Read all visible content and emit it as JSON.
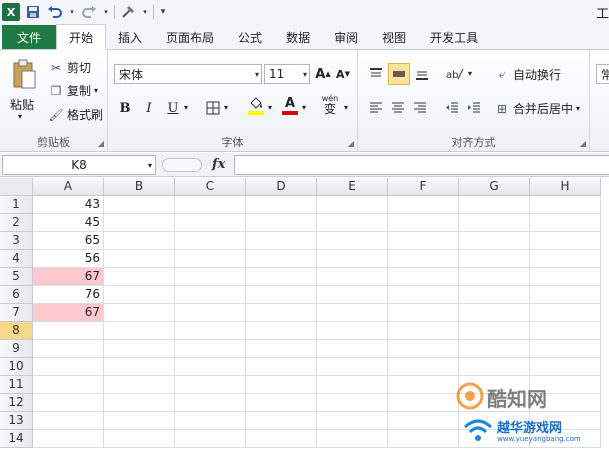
{
  "app": {
    "title_fragment": "工",
    "logo": "X"
  },
  "qat": {
    "save_icon": "save-icon",
    "undo_icon": "undo-icon",
    "redo_icon": "redo-icon"
  },
  "tabs": [
    {
      "label": "文件"
    },
    {
      "label": "开始"
    },
    {
      "label": "插入"
    },
    {
      "label": "页面布局"
    },
    {
      "label": "公式"
    },
    {
      "label": "数据"
    },
    {
      "label": "审阅"
    },
    {
      "label": "视图"
    },
    {
      "label": "开发工具"
    }
  ],
  "ribbon": {
    "clipboard": {
      "paste": "粘贴",
      "cut": "剪切",
      "copy": "复制",
      "format_painter": "格式刷",
      "group": "剪贴板"
    },
    "font": {
      "name": "宋体",
      "size": "11",
      "grow": "A",
      "shrink": "A",
      "bold": "B",
      "italic": "I",
      "underline": "U",
      "color_letter": "A",
      "phonetic": "wén",
      "phonetic_char": "变",
      "group": "字体"
    },
    "alignment": {
      "wrap": "自动换行",
      "merge": "合并后居中",
      "group": "对齐方式"
    },
    "number": {
      "format_fragment": "常"
    }
  },
  "formula_bar": {
    "name_box": "K8",
    "fx": "fx",
    "value": ""
  },
  "sheet": {
    "columns": [
      "A",
      "B",
      "C",
      "D",
      "E",
      "F",
      "G",
      "H"
    ],
    "rows": [
      "1",
      "2",
      "3",
      "4",
      "5",
      "6",
      "7",
      "8",
      "9",
      "10",
      "11",
      "12",
      "13",
      "14"
    ],
    "column_a_values": [
      "43",
      "45",
      "65",
      "56",
      "67",
      "76",
      "67",
      "",
      "",
      "",
      "",
      "",
      "",
      ""
    ],
    "highlight_rows": [
      5,
      7
    ],
    "selected_row": 8,
    "highlight_color": "#ffc7ce"
  },
  "watermark": {
    "brand": "酷知网",
    "site_name": "越华游戏网",
    "url": "www.yueyangbang.com"
  }
}
